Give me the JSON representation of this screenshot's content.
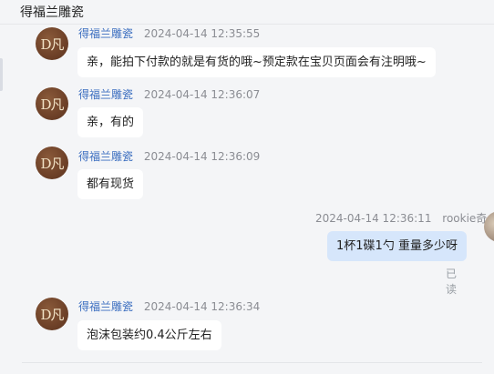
{
  "window": {
    "title": "得福兰雕瓷"
  },
  "messages": [
    {
      "sender": "得福兰雕瓷",
      "time": "2024-04-14 12:35:55",
      "text": "亲，能拍下付款的就是有货的哦~预定款在宝贝页面会有注明哦~",
      "avatar_label": "D凡"
    },
    {
      "sender": "得福兰雕瓷",
      "time": "2024-04-14 12:36:07",
      "text": "亲，有的",
      "avatar_label": "D凡"
    },
    {
      "sender": "得福兰雕瓷",
      "time": "2024-04-14 12:36:09",
      "text": "都有现货",
      "avatar_label": "D凡"
    },
    {
      "sender": "rookie奇",
      "time": "2024-04-14 12:36:11",
      "text": "1杯1碟1勺   重量多少呀",
      "status": "已读"
    },
    {
      "sender": "得福兰雕瓷",
      "time": "2024-04-14 12:36:34",
      "text": "泡沫包装约0.4公斤左右",
      "avatar_label": "D凡"
    }
  ],
  "colors": {
    "background": "#f4f5f7",
    "bubble_other": "#ffffff",
    "bubble_self": "#d6e6fb",
    "name_link": "#3d6fc0",
    "timestamp": "#8b8d93"
  }
}
